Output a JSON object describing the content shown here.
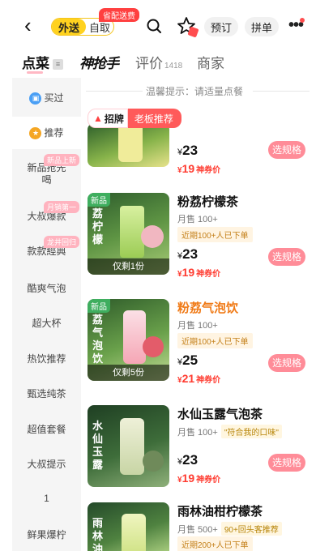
{
  "header": {
    "mode_active": "外送",
    "mode_inactive": "自取",
    "fee_badge": "省配送费",
    "reserve_label": "预订",
    "group_label": "拼单"
  },
  "tabs": {
    "order": "点菜",
    "shenqiang": "神抢手",
    "review": "评价",
    "review_count": "1418",
    "merchant": "商家"
  },
  "sidebar": {
    "items": [
      {
        "label": "买过",
        "badge": ""
      },
      {
        "label": "推荐",
        "badge": ""
      },
      {
        "label": "新品抢先喝",
        "badge": "新品上新"
      },
      {
        "label": "大叔爆款",
        "badge": "月销第一"
      },
      {
        "label": "款款經典",
        "badge": "龙井回归"
      },
      {
        "label": "酷爽气泡",
        "badge": ""
      },
      {
        "label": "超大杯",
        "badge": ""
      },
      {
        "label": "热饮推荐",
        "badge": ""
      },
      {
        "label": "甄选纯茶",
        "badge": ""
      },
      {
        "label": "超值套餐",
        "badge": ""
      },
      {
        "label": "大叔提示",
        "badge": ""
      },
      {
        "label": "1",
        "badge": ""
      },
      {
        "label": "鲜果爆柠",
        "badge": ""
      }
    ]
  },
  "main": {
    "tip": "温馨提示：请适量点餐",
    "promo_hot": "招牌",
    "promo_boss": "老板推荐",
    "spec_label": "选规格",
    "coupon_label": "神券价",
    "yen": "¥",
    "products": [
      {
        "name": "",
        "sales": "",
        "recent": "",
        "price": "23",
        "coupon_price": "19",
        "stock": "",
        "new_tag": "",
        "thumb_text": "",
        "note": ""
      },
      {
        "name": "粉荔柠檬茶",
        "sales": "月售 100+",
        "recent": "近期100+人已下单",
        "price": "23",
        "coupon_price": "19",
        "stock": "仅剩1份",
        "new_tag": "新品",
        "thumb_text": "荔柠檬",
        "note": ""
      },
      {
        "name": "粉荔气泡饮",
        "sales": "月售 100+",
        "recent": "近期100+人已下单",
        "price": "25",
        "coupon_price": "21",
        "stock": "仅剩5份",
        "new_tag": "新品",
        "thumb_text": "荔气泡饮",
        "note": ""
      },
      {
        "name": "水仙玉露气泡茶",
        "sales": "月售 100+",
        "recent": "",
        "price": "23",
        "coupon_price": "19",
        "stock": "",
        "new_tag": "",
        "thumb_text": "水仙玉露",
        "note": "\"符合我的口味\""
      },
      {
        "name": "雨林油柑柠檬茶",
        "sales": "月售 500+",
        "recent": "近期200+人已下单",
        "price": "",
        "coupon_price": "",
        "stock": "",
        "new_tag": "",
        "thumb_text": "雨林油柑",
        "note": "90+回头客推荐"
      }
    ]
  },
  "colors": {
    "accent_yellow": "#ffd21f",
    "price_red": "#ff3b30",
    "spec_pink": "#ff8c98",
    "name_orange": "#f07a16"
  }
}
